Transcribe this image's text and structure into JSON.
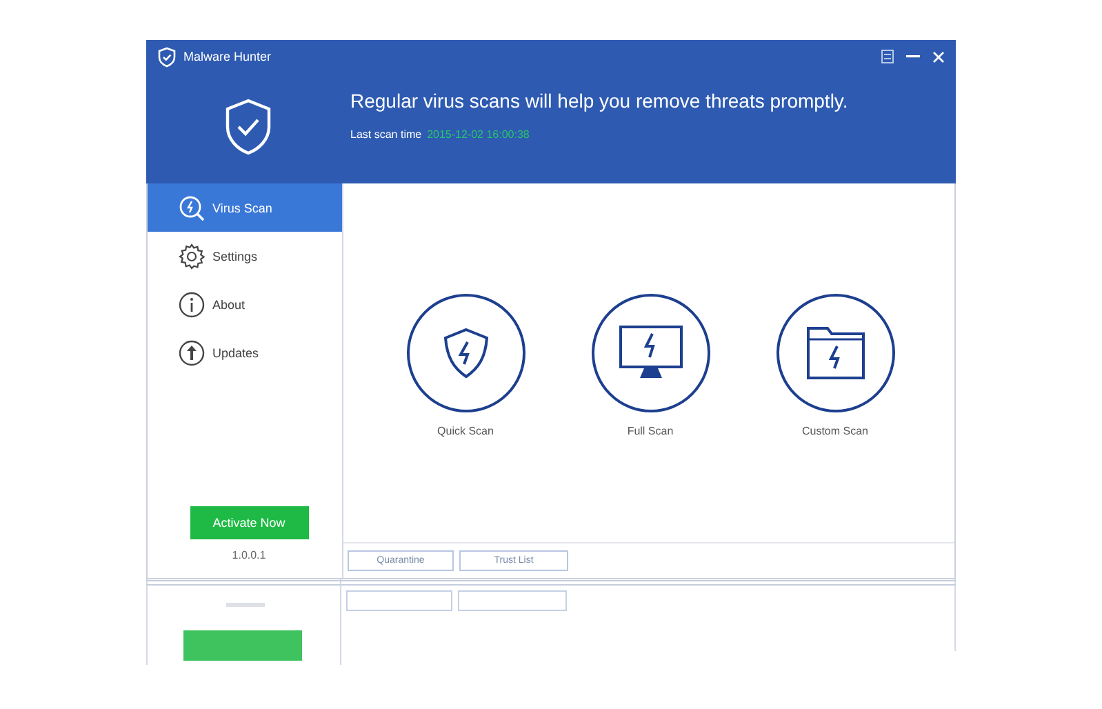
{
  "window": {
    "title": "Malware Hunter"
  },
  "header": {
    "message": "Regular virus scans will help you remove threats promptly.",
    "last_scan_label": "Last scan time",
    "last_scan_time": "2015-12-02 16:00:38"
  },
  "sidebar": {
    "items": [
      {
        "label": "Virus Scan",
        "kind": "scan",
        "selected": true
      },
      {
        "label": "Settings",
        "kind": "settings",
        "selected": false
      },
      {
        "label": "About",
        "kind": "about",
        "selected": false
      },
      {
        "label": "Updates",
        "kind": "updates",
        "selected": false
      }
    ],
    "activate_button": "Activate Now",
    "version": "1.0.0.1"
  },
  "scan_options": [
    {
      "label": "Quick Scan",
      "kind": "shield"
    },
    {
      "label": "Full Scan",
      "kind": "monitor"
    },
    {
      "label": "Custom Scan",
      "kind": "folder"
    }
  ],
  "footer_buttons": [
    "Quarantine",
    "Trust List"
  ]
}
